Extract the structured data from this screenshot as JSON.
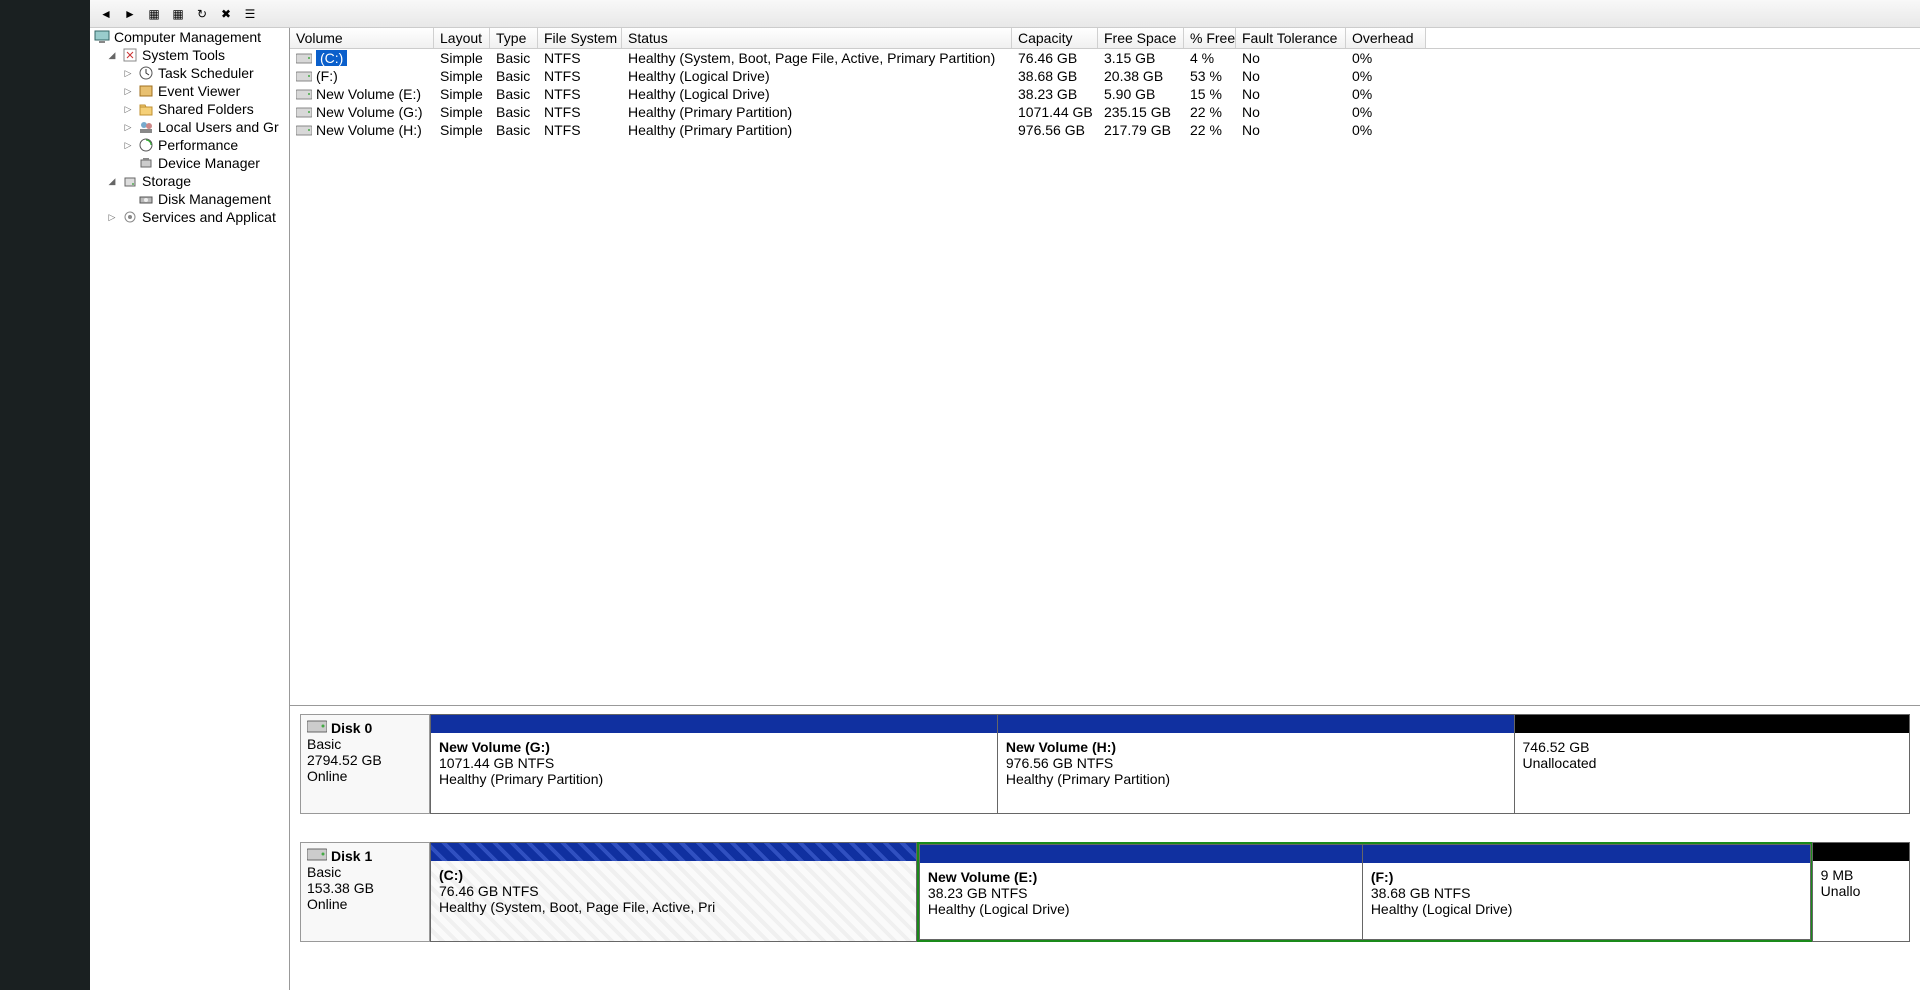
{
  "tree": {
    "root": "Computer Management",
    "system_tools": "System Tools",
    "task_scheduler": "Task Scheduler",
    "event_viewer": "Event Viewer",
    "shared_folders": "Shared Folders",
    "local_users": "Local Users and Gr",
    "performance": "Performance",
    "device_manager": "Device Manager",
    "storage": "Storage",
    "disk_management": "Disk Management",
    "services": "Services and Applicat"
  },
  "columns": {
    "volume": "Volume",
    "layout": "Layout",
    "type": "Type",
    "fs": "File System",
    "status": "Status",
    "capacity": "Capacity",
    "free": "Free Space",
    "pct": "% Free",
    "fault": "Fault Tolerance",
    "over": "Overhead"
  },
  "volumes": [
    {
      "name": "(C:)",
      "layout": "Simple",
      "type": "Basic",
      "fs": "NTFS",
      "status": "Healthy (System, Boot, Page File, Active, Primary Partition)",
      "cap": "76.46 GB",
      "free": "3.15 GB",
      "pct": "4 %",
      "fault": "No",
      "over": "0%",
      "selected": true
    },
    {
      "name": "(F:)",
      "layout": "Simple",
      "type": "Basic",
      "fs": "NTFS",
      "status": "Healthy (Logical Drive)",
      "cap": "38.68 GB",
      "free": "20.38 GB",
      "pct": "53 %",
      "fault": "No",
      "over": "0%"
    },
    {
      "name": "New Volume (E:)",
      "layout": "Simple",
      "type": "Basic",
      "fs": "NTFS",
      "status": "Healthy (Logical Drive)",
      "cap": "38.23 GB",
      "free": "5.90 GB",
      "pct": "15 %",
      "fault": "No",
      "over": "0%"
    },
    {
      "name": "New Volume (G:)",
      "layout": "Simple",
      "type": "Basic",
      "fs": "NTFS",
      "status": "Healthy (Primary Partition)",
      "cap": "1071.44 GB",
      "free": "235.15 GB",
      "pct": "22 %",
      "fault": "No",
      "over": "0%"
    },
    {
      "name": "New Volume (H:)",
      "layout": "Simple",
      "type": "Basic",
      "fs": "NTFS",
      "status": "Healthy (Primary Partition)",
      "cap": "976.56 GB",
      "free": "217.79 GB",
      "pct": "22 %",
      "fault": "No",
      "over": "0%"
    }
  ],
  "disks": [
    {
      "label": "Disk 0",
      "type": "Basic",
      "size": "2794.52 GB",
      "state": "Online",
      "parts": [
        {
          "name": "New Volume  (G:)",
          "sz": "1071.44 GB NTFS",
          "st": "Healthy (Primary Partition)",
          "bar": "primary",
          "flex": 383
        },
        {
          "name": "New Volume  (H:)",
          "sz": "976.56 GB NTFS",
          "st": "Healthy (Primary Partition)",
          "bar": "primary",
          "flex": 349
        },
        {
          "name": "",
          "sz": "746.52 GB",
          "st": "Unallocated",
          "bar": "unalloc",
          "flex": 267
        }
      ]
    },
    {
      "label": "Disk 1",
      "type": "Basic",
      "size": "153.38 GB",
      "state": "Online",
      "parts": [
        {
          "name": "(C:)",
          "sz": "76.46 GB NTFS",
          "st": "Healthy (System, Boot, Page File, Active, Pri",
          "bar": "hatch",
          "flex": 292,
          "hatchbody": true
        },
        {
          "ext": true,
          "items": [
            {
              "name": "New Volume  (E:)",
              "sz": "38.23 GB NTFS",
              "st": "Healthy (Logical Drive)",
              "bar": "primary",
              "flex": 267
            },
            {
              "name": "(F:)",
              "sz": "38.68 GB NTFS",
              "st": "Healthy (Logical Drive)",
              "bar": "primary",
              "flex": 270
            }
          ],
          "flex": 537
        },
        {
          "name": "",
          "sz": "9 MB",
          "st": "Unallo",
          "bar": "unalloc",
          "flex": 58
        }
      ]
    }
  ]
}
